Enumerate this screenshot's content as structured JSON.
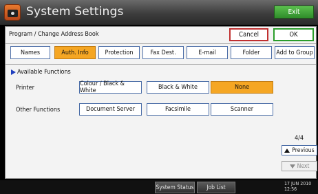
{
  "window": {
    "title": "System Settings",
    "exit_label": "Exit"
  },
  "header": {
    "path": "Program / Change Address Book",
    "cancel_label": "Cancel",
    "ok_label": "OK"
  },
  "tabs": [
    {
      "label": "Names",
      "active": false
    },
    {
      "label": "Auth. Info",
      "active": true
    },
    {
      "label": "Protection",
      "active": false
    },
    {
      "label": "Fax Dest.",
      "active": false
    },
    {
      "label": "E-mail",
      "active": false
    },
    {
      "label": "Folder",
      "active": false
    },
    {
      "label": "Add to Group",
      "active": false
    }
  ],
  "available_functions": {
    "title": "Available Functions",
    "printer": {
      "label": "Printer",
      "options": [
        "Colour / Black & White",
        "Black & White",
        "None"
      ],
      "selected": "None"
    },
    "other": {
      "label": "Other Functions",
      "options": [
        "Document Server",
        "Facsimile",
        "Scanner"
      ]
    }
  },
  "pager": {
    "page": "4/4",
    "previous_label": "Previous",
    "next_label": "Next"
  },
  "statusbar": {
    "system_status_label": "System Status",
    "job_list_label": "Job List",
    "date": "17 JUN 2010",
    "time": "12:56"
  },
  "colors": {
    "active": "#f5a623",
    "ok_border": "#2a9d2a",
    "cancel_border": "#c03030",
    "exit": "#3aa33a"
  },
  "icons": {
    "app": "camera-settings-icon",
    "section": "triangle-right-icon",
    "prev": "triangle-up-icon",
    "next": "triangle-down-icon"
  }
}
